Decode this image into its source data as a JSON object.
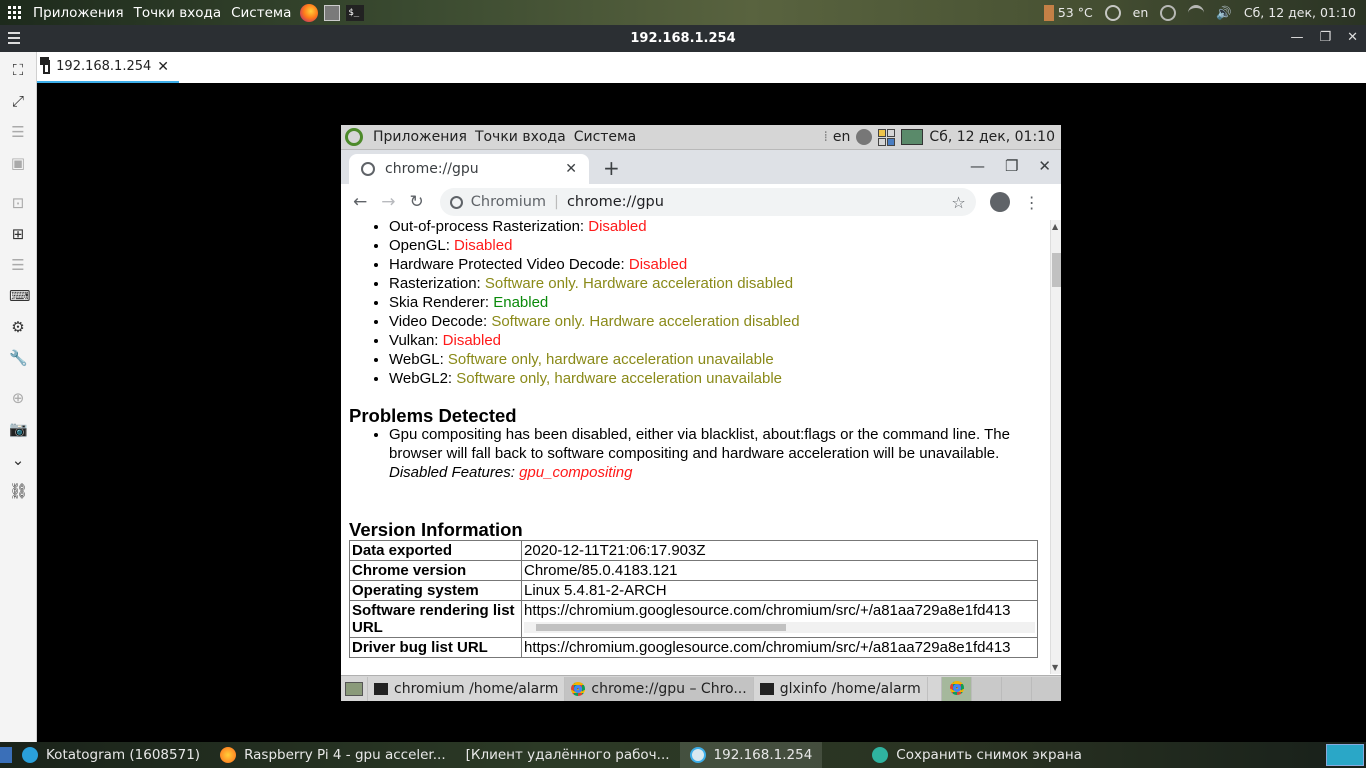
{
  "host_top": {
    "menus": [
      "Приложения",
      "Точки входа",
      "Система"
    ],
    "temperature": "53 °C",
    "keyboard_layout": "en",
    "datetime": "Сб, 12 дек, 01:10"
  },
  "remmina": {
    "window_title": "192.168.1.254",
    "tab_label": "192.168.1.254"
  },
  "remote_panel": {
    "menus": [
      "Приложения",
      "Точки входа",
      "Система"
    ],
    "keyboard_layout": "en",
    "datetime": "Сб, 12 дек, 01:10"
  },
  "chromium": {
    "tab_title": "chrome://gpu",
    "omnibox_site": "Chromium",
    "omnibox_url": "chrome://gpu",
    "features": [
      {
        "name": "Out-of-process Rasterization: ",
        "status": "Disabled",
        "color": "red"
      },
      {
        "name": "OpenGL: ",
        "status": "Disabled",
        "color": "red"
      },
      {
        "name": "Hardware Protected Video Decode: ",
        "status": "Disabled",
        "color": "red"
      },
      {
        "name": "Rasterization: ",
        "status": "Software only. Hardware acceleration disabled",
        "color": "olive"
      },
      {
        "name": "Skia Renderer: ",
        "status": "Enabled",
        "color": "green"
      },
      {
        "name": "Video Decode: ",
        "status": "Software only. Hardware acceleration disabled",
        "color": "olive"
      },
      {
        "name": "Vulkan: ",
        "status": "Disabled",
        "color": "red"
      },
      {
        "name": "WebGL: ",
        "status": "Software only, hardware acceleration unavailable",
        "color": "olive"
      },
      {
        "name": "WebGL2: ",
        "status": "Software only, hardware acceleration unavailable",
        "color": "olive"
      }
    ],
    "problems_title": "Problems Detected",
    "problem_text": "Gpu compositing has been disabled, either via blacklist, about:flags or the command line. The browser will fall back to software compositing and hardware acceleration will be unavailable.",
    "disabled_features_label": "Disabled Features: ",
    "disabled_features_value": "gpu_compositing",
    "version_title": "Version Information",
    "version_rows": [
      {
        "key": "Data exported",
        "value": "2020-12-11T21:06:17.903Z"
      },
      {
        "key": "Chrome version",
        "value": "Chrome/85.0.4183.121"
      },
      {
        "key": "Operating system",
        "value": "Linux 5.4.81-2-ARCH"
      },
      {
        "key": "Software rendering list URL",
        "value": "https://chromium.googlesource.com/chromium/src/+/a81aa729a8e1fd413"
      },
      {
        "key": "Driver bug list URL",
        "value": "https://chromium.googlesource.com/chromium/src/+/a81aa729a8e1fd413"
      }
    ]
  },
  "remote_taskbar": {
    "items": [
      "chromium /home/alarm",
      "chrome://gpu – Chro...",
      "glxinfo /home/alarm"
    ]
  },
  "host_bottom": {
    "items": [
      "Kotatogram (1608571)",
      "Raspberry Pi 4 - gpu acceler...",
      "[Клиент удалённого рабоч...",
      "192.168.1.254",
      "Сохранить снимок экрана"
    ]
  },
  "colors": {
    "disabled_red": "#ff1a1a",
    "software_olive": "#8a8a19",
    "enabled_green": "#0a8a0a",
    "remmina_accent": "#3daee9"
  }
}
